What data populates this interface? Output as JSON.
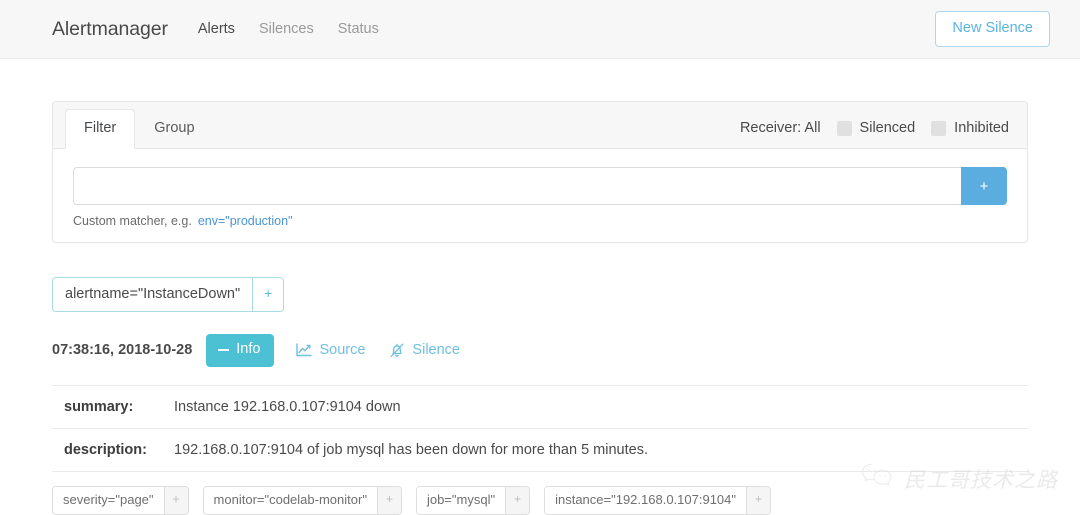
{
  "navbar": {
    "brand": "Alertmanager",
    "links": [
      {
        "label": "Alerts",
        "active": true
      },
      {
        "label": "Silences",
        "active": false
      },
      {
        "label": "Status",
        "active": false
      }
    ],
    "new_silence_label": "New Silence"
  },
  "filter_card": {
    "tabs": [
      {
        "label": "Filter",
        "active": true
      },
      {
        "label": "Group",
        "active": false
      }
    ],
    "receiver_label": "Receiver: All",
    "toggles": [
      {
        "label": "Silenced",
        "checked": false
      },
      {
        "label": "Inhibited",
        "checked": false
      }
    ],
    "matcher_input_value": "",
    "matcher_input_placeholder": "",
    "matcher_add_label": "+",
    "hint_text": "Custom matcher, e.g.",
    "hint_example": "env=\"production\""
  },
  "group": {
    "chip_label": "alertname=\"InstanceDown\"",
    "chip_add_label": "+"
  },
  "alert": {
    "timestamp": "07:38:16, 2018-10-28",
    "info_label": "Info",
    "source_label": "Source",
    "silence_label": "Silence",
    "annotations": [
      {
        "key": "summary:",
        "value": "Instance 192.168.0.107:9104 down"
      },
      {
        "key": "description:",
        "value": "192.168.0.107:9104 of job mysql has been down for more than 5 minutes."
      }
    ],
    "labels": [
      {
        "text": "severity=\"page\"",
        "add": "+"
      },
      {
        "text": "monitor=\"codelab-monitor\"",
        "add": "+"
      },
      {
        "text": "job=\"mysql\"",
        "add": "+"
      },
      {
        "text": "instance=\"192.168.0.107:9104\"",
        "add": "+"
      }
    ]
  },
  "watermark": {
    "text": "民工哥技术之路"
  },
  "colors": {
    "accent_blue": "#5bacdf",
    "link_blue": "#71bfe0",
    "info_teal": "#4cc1d4",
    "navbar_bg": "#f7f7f7",
    "card_header_bg": "#f7f7f7",
    "border": "#e6e6e6"
  }
}
